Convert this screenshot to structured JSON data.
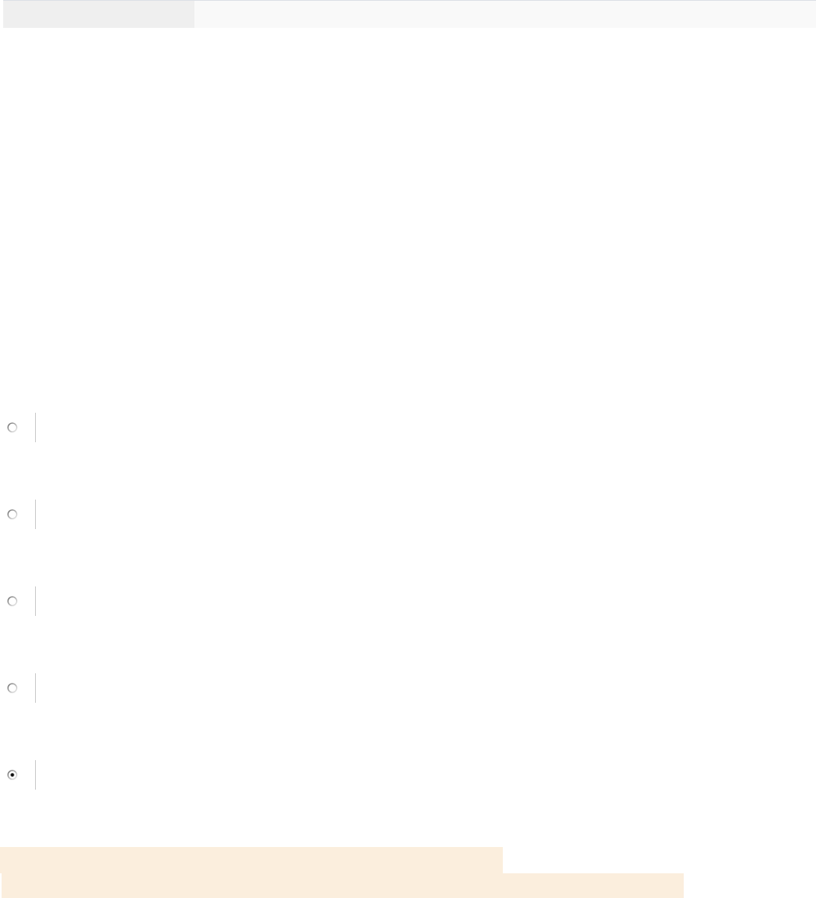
{
  "radio_options": [
    {
      "selected": false
    },
    {
      "selected": false
    },
    {
      "selected": false
    },
    {
      "selected": false
    },
    {
      "selected": true
    }
  ]
}
